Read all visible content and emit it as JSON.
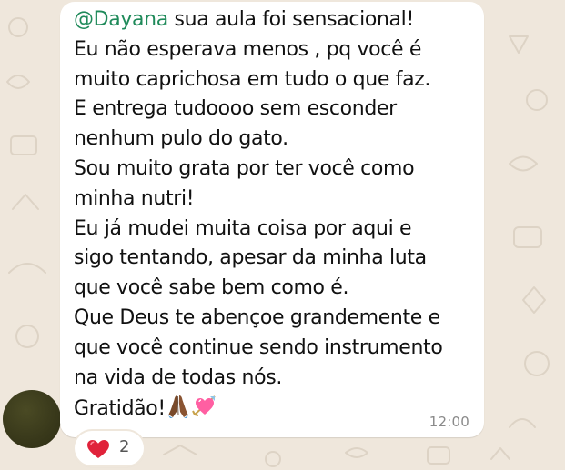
{
  "message": {
    "mention": "@Dayana",
    "line1_rest": " sua aula foi sensacional!",
    "lines": [
      "Eu não esperava menos , pq você é",
      "muito caprichosa em tudo o que faz.",
      "E entrega tudoooo sem esconder",
      "nenhum pulo do gato.",
      "Sou muito grata por ter você como",
      "minha nutri!",
      "Eu já mudei muita coisa por aqui e",
      "sigo tentando, apesar da minha luta",
      "que você sabe bem como é.",
      "Que Deus te abençoe grandemente e",
      "que você continue sendo instrumento",
      "na vida de todas nós."
    ],
    "last_line": "Gratidão!",
    "emojis": [
      "praying-hands",
      "heart-with-arrow"
    ],
    "time": "12:00"
  },
  "reaction": {
    "emoji": "red-heart",
    "count": "2"
  },
  "colors": {
    "mention": "#1f8a5a",
    "bubble": "#ffffff",
    "wallpaper": "#efe7dc",
    "heart": "#e0223a"
  }
}
